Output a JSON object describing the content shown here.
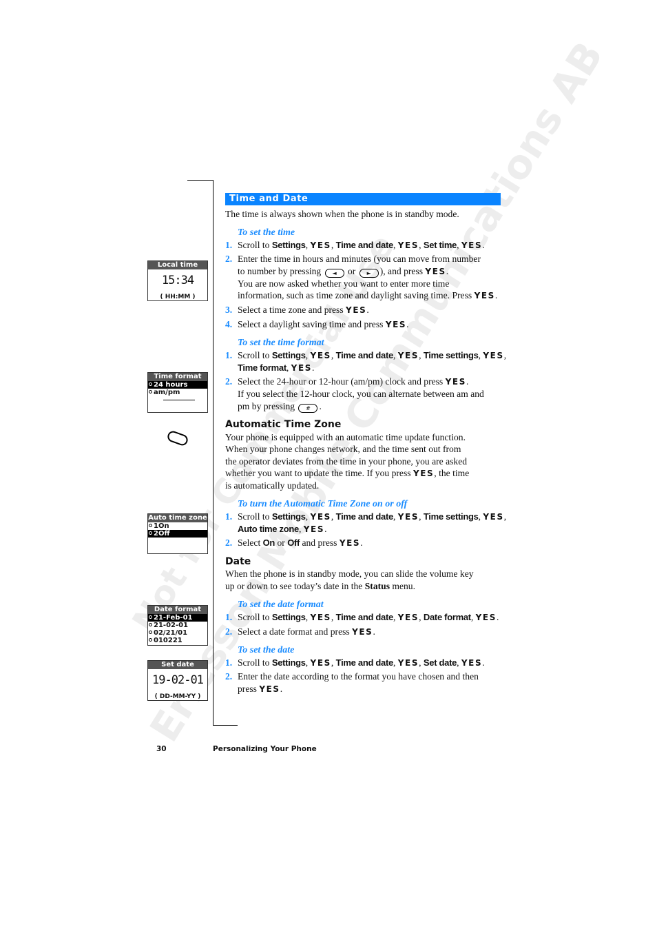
{
  "section": {
    "title": "Time and Date"
  },
  "watermark": [
    "Ericsson Mobile Communications AB",
    "Not for Commercial Use"
  ],
  "text_lines": [
    {
      "kind": "paragraph",
      "segs": [
        [
          "n",
          "The time is always shown when the phone is in standby mode."
        ]
      ]
    },
    {
      "kind": "heading",
      "segs": [
        [
          "n",
          "To set the time"
        ]
      ]
    },
    {
      "kind": "step",
      "num": "1.",
      "segs": [
        [
          "n",
          "Scroll to "
        ],
        [
          "b",
          "Settings"
        ],
        [
          "n",
          ", "
        ],
        [
          "y",
          "YES"
        ],
        [
          "n",
          ", "
        ],
        [
          "b",
          "Time and date"
        ],
        [
          "n",
          ", "
        ],
        [
          "y",
          "YES"
        ],
        [
          "n",
          ", "
        ],
        [
          "b",
          "Set time"
        ],
        [
          "n",
          ", "
        ],
        [
          "y",
          "YES"
        ],
        [
          "n",
          "."
        ]
      ]
    },
    {
      "kind": "step",
      "num": "2.",
      "segs": [
        [
          "n",
          "Enter the time in hours and minutes (you can move from number"
        ]
      ]
    },
    {
      "kind": "cont",
      "segs": [
        [
          "n",
          "to number by pressing "
        ],
        [
          "k",
          "left-arrow-key"
        ],
        [
          "n",
          " or "
        ],
        [
          "k",
          "right-arrow-key"
        ],
        [
          "n",
          "), and press "
        ],
        [
          "y",
          "YES"
        ],
        [
          "n",
          "."
        ]
      ]
    },
    {
      "kind": "cont",
      "segs": [
        [
          "n",
          "You are now asked whether you want to enter more time"
        ]
      ]
    },
    {
      "kind": "cont",
      "segs": [
        [
          "n",
          "information, such as time zone and daylight saving time. Press "
        ],
        [
          "y",
          "YES"
        ],
        [
          "n",
          "."
        ]
      ]
    },
    {
      "kind": "step",
      "num": "3.",
      "segs": [
        [
          "n",
          "Select a time zone and press "
        ],
        [
          "y",
          "YES"
        ],
        [
          "n",
          "."
        ]
      ]
    },
    {
      "kind": "step",
      "num": "4.",
      "segs": [
        [
          "n",
          "Select a daylight saving time and press "
        ],
        [
          "y",
          "YES"
        ],
        [
          "n",
          "."
        ]
      ]
    },
    {
      "kind": "heading",
      "segs": [
        [
          "n",
          "To set the time format"
        ]
      ]
    },
    {
      "kind": "step",
      "num": "1.",
      "segs": [
        [
          "n",
          "Scroll to "
        ],
        [
          "b",
          "Settings"
        ],
        [
          "n",
          ", "
        ],
        [
          "y",
          "YES"
        ],
        [
          "n",
          ", "
        ],
        [
          "b",
          "Time and date"
        ],
        [
          "n",
          ", "
        ],
        [
          "y",
          "YES"
        ],
        [
          "n",
          ", "
        ],
        [
          "b",
          "Time settings"
        ],
        [
          "n",
          ", "
        ],
        [
          "y",
          "YES"
        ],
        [
          "n",
          ","
        ]
      ]
    },
    {
      "kind": "cont",
      "segs": [
        [
          "b",
          "Time format"
        ],
        [
          "n",
          ", "
        ],
        [
          "y",
          "YES"
        ],
        [
          "n",
          "."
        ]
      ]
    },
    {
      "kind": "step",
      "num": "2.",
      "segs": [
        [
          "n",
          "Select the 24-hour or 12-hour (am/pm) clock and press "
        ],
        [
          "y",
          "YES"
        ],
        [
          "n",
          "."
        ]
      ]
    },
    {
      "kind": "cont",
      "segs": [
        [
          "n",
          "If you select the 12-hour clock, you can alternate between am and"
        ]
      ]
    },
    {
      "kind": "cont",
      "segs": [
        [
          "n",
          "pm by pressing "
        ],
        [
          "k",
          "hash-key"
        ],
        [
          "n",
          "."
        ]
      ]
    },
    {
      "kind": "subheading",
      "segs": [
        [
          "n",
          "Automatic Time Zone"
        ]
      ]
    },
    {
      "kind": "paragraph",
      "segs": [
        [
          "n",
          "Your phone is equipped with an automatic time update function."
        ]
      ]
    },
    {
      "kind": "paragraph",
      "segs": [
        [
          "n",
          "When your phone changes network, and the time sent out from"
        ]
      ]
    },
    {
      "kind": "paragraph",
      "segs": [
        [
          "n",
          "the operator deviates from the time in your phone, you are asked"
        ]
      ]
    },
    {
      "kind": "paragraph",
      "segs": [
        [
          "n",
          "whether you want to update the time. If you press "
        ],
        [
          "y",
          "YES"
        ],
        [
          "n",
          ", the time"
        ]
      ]
    },
    {
      "kind": "paragraph",
      "segs": [
        [
          "n",
          "is automatically updated."
        ]
      ]
    },
    {
      "kind": "heading",
      "segs": [
        [
          "n",
          "To turn the Automatic Time Zone on or off"
        ]
      ]
    },
    {
      "kind": "step",
      "num": "1.",
      "segs": [
        [
          "n",
          "Scroll to "
        ],
        [
          "b",
          "Settings"
        ],
        [
          "n",
          ", "
        ],
        [
          "y",
          "YES"
        ],
        [
          "n",
          ", "
        ],
        [
          "b",
          "Time and date"
        ],
        [
          "n",
          ", "
        ],
        [
          "y",
          "YES"
        ],
        [
          "n",
          ", "
        ],
        [
          "b",
          "Time settings"
        ],
        [
          "n",
          ", "
        ],
        [
          "y",
          "YES"
        ],
        [
          "n",
          ","
        ]
      ]
    },
    {
      "kind": "cont",
      "segs": [
        [
          "b",
          "Auto time zone"
        ],
        [
          "n",
          ", "
        ],
        [
          "y",
          "YES"
        ],
        [
          "n",
          "."
        ]
      ]
    },
    {
      "kind": "step",
      "num": "2.",
      "segs": [
        [
          "n",
          "Select "
        ],
        [
          "b",
          "On"
        ],
        [
          "n",
          " or "
        ],
        [
          "b",
          "Off"
        ],
        [
          "n",
          " and press "
        ],
        [
          "y",
          "YES"
        ],
        [
          "n",
          "."
        ]
      ]
    },
    {
      "kind": "subheading",
      "segs": [
        [
          "n",
          "Date"
        ]
      ]
    },
    {
      "kind": "paragraph",
      "segs": [
        [
          "n",
          "When the phone is in standby mode, you can slide the volume key"
        ]
      ]
    },
    {
      "kind": "paragraph",
      "segs": [
        [
          "n",
          "up or down to see today’s date in the "
        ],
        [
          "s",
          "Status"
        ],
        [
          "n",
          " menu."
        ]
      ]
    },
    {
      "kind": "heading",
      "segs": [
        [
          "n",
          "To set the date format"
        ]
      ]
    },
    {
      "kind": "step",
      "num": "1.",
      "segs": [
        [
          "n",
          "Scroll to "
        ],
        [
          "b",
          "Settings"
        ],
        [
          "n",
          ", "
        ],
        [
          "y",
          "YES"
        ],
        [
          "n",
          ", "
        ],
        [
          "b",
          "Time and date"
        ],
        [
          "n",
          ", "
        ],
        [
          "y",
          "YES"
        ],
        [
          "n",
          ", "
        ],
        [
          "b",
          "Date format"
        ],
        [
          "n",
          ", "
        ],
        [
          "y",
          "YES"
        ],
        [
          "n",
          "."
        ]
      ]
    },
    {
      "kind": "step",
      "num": "2.",
      "segs": [
        [
          "n",
          "Select a date format and press "
        ],
        [
          "y",
          "YES"
        ],
        [
          "n",
          "."
        ]
      ]
    },
    {
      "kind": "heading",
      "segs": [
        [
          "n",
          "To set the date"
        ]
      ]
    },
    {
      "kind": "step",
      "num": "1.",
      "segs": [
        [
          "n",
          "Scroll to "
        ],
        [
          "b",
          "Settings"
        ],
        [
          "n",
          ", "
        ],
        [
          "y",
          "YES"
        ],
        [
          "n",
          ", "
        ],
        [
          "b",
          "Time and date"
        ],
        [
          "n",
          ", "
        ],
        [
          "y",
          "YES"
        ],
        [
          "n",
          ", "
        ],
        [
          "b",
          "Set date"
        ],
        [
          "n",
          ", "
        ],
        [
          "y",
          "YES"
        ],
        [
          "n",
          "."
        ]
      ]
    },
    {
      "kind": "step",
      "num": "2.",
      "segs": [
        [
          "n",
          "Enter the date according to the format you have chosen and then"
        ]
      ]
    },
    {
      "kind": "cont",
      "segs": [
        [
          "n",
          "press "
        ],
        [
          "y",
          "YES"
        ],
        [
          "n",
          "."
        ]
      ]
    }
  ],
  "screens": {
    "local_time": {
      "title": "Local time",
      "value": "15:34",
      "hint": "( HH:MM )"
    },
    "time_format": {
      "title": "Time format",
      "options": [
        "24 hours",
        "am/pm"
      ],
      "selected": 0
    },
    "auto_time_zone": {
      "title": "Auto time zone",
      "options": [
        "1On",
        "2Off"
      ],
      "selected": 1
    },
    "date_format": {
      "title": "Date format",
      "options": [
        "21-Feb-01",
        "21-02-01",
        "02/21/01",
        "010221"
      ],
      "selected": 0
    },
    "set_date": {
      "title": "Set date",
      "value": "19-02-01",
      "hint": "( DD-MM-YY )"
    }
  },
  "side_icon": "volume-key-icon",
  "footer": {
    "page_number": "30",
    "chapter": "Personalizing Your Phone"
  },
  "colors": {
    "accent": "#0a84ff",
    "heading": "#1a8cff"
  }
}
